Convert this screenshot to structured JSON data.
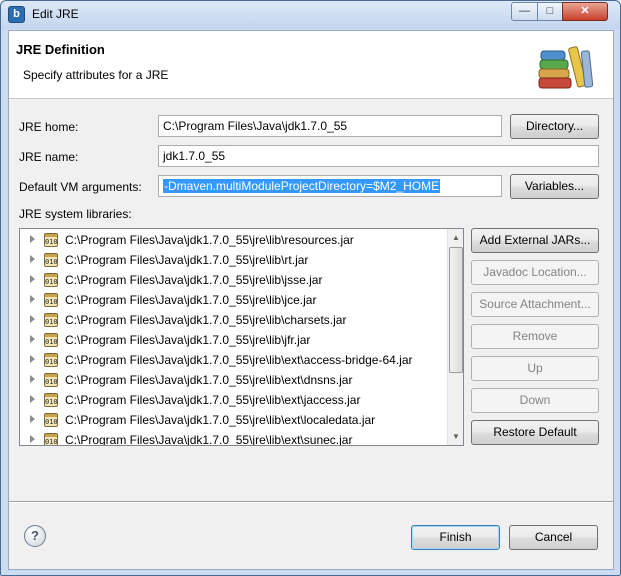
{
  "window": {
    "title": "Edit JRE",
    "app_icon_letter": "b",
    "minimize_glyph": "—",
    "maximize_glyph": "□",
    "close_glyph": "✕"
  },
  "banner": {
    "title": "JRE Definition",
    "description": "Specify attributes for a JRE",
    "icon": "library-books-icon"
  },
  "form": {
    "jre_home_label": "JRE home:",
    "jre_home_value": "C:\\Program Files\\Java\\jdk1.7.0_55",
    "directory_button": "Directory...",
    "jre_name_label": "JRE name:",
    "jre_name_value": "jdk1.7.0_55",
    "vm_args_label": "Default VM arguments:",
    "vm_args_value": "-Dmaven.multiModuleProjectDirectory=$M2_HOME",
    "variables_button": "Variables...",
    "libraries_label": "JRE system libraries:"
  },
  "libraries": [
    {
      "path": "C:\\Program Files\\Java\\jdk1.7.0_55\\jre\\lib\\resources.jar",
      "badge": "010"
    },
    {
      "path": "C:\\Program Files\\Java\\jdk1.7.0_55\\jre\\lib\\rt.jar",
      "badge": "010"
    },
    {
      "path": "C:\\Program Files\\Java\\jdk1.7.0_55\\jre\\lib\\jsse.jar",
      "badge": "010"
    },
    {
      "path": "C:\\Program Files\\Java\\jdk1.7.0_55\\jre\\lib\\jce.jar",
      "badge": "010"
    },
    {
      "path": "C:\\Program Files\\Java\\jdk1.7.0_55\\jre\\lib\\charsets.jar",
      "badge": "010"
    },
    {
      "path": "C:\\Program Files\\Java\\jdk1.7.0_55\\jre\\lib\\jfr.jar",
      "badge": "010"
    },
    {
      "path": "C:\\Program Files\\Java\\jdk1.7.0_55\\jre\\lib\\ext\\access-bridge-64.jar",
      "badge": "010"
    },
    {
      "path": "C:\\Program Files\\Java\\jdk1.7.0_55\\jre\\lib\\ext\\dnsns.jar",
      "badge": "010"
    },
    {
      "path": "C:\\Program Files\\Java\\jdk1.7.0_55\\jre\\lib\\ext\\jaccess.jar",
      "badge": "010"
    },
    {
      "path": "C:\\Program Files\\Java\\jdk1.7.0_55\\jre\\lib\\ext\\localedata.jar",
      "badge": "010"
    },
    {
      "path": "C:\\Program Files\\Java\\jdk1.7.0_55\\jre\\lib\\ext\\sunec.jar",
      "badge": "010"
    }
  ],
  "side_buttons": {
    "add_external_jars": "Add External JARs...",
    "javadoc_location": "Javadoc Location...",
    "source_attachment": "Source Attachment...",
    "remove": "Remove",
    "up": "Up",
    "down": "Down",
    "restore_default": "Restore Default"
  },
  "footer": {
    "help_glyph": "?",
    "finish_button": "Finish",
    "cancel_button": "Cancel"
  }
}
